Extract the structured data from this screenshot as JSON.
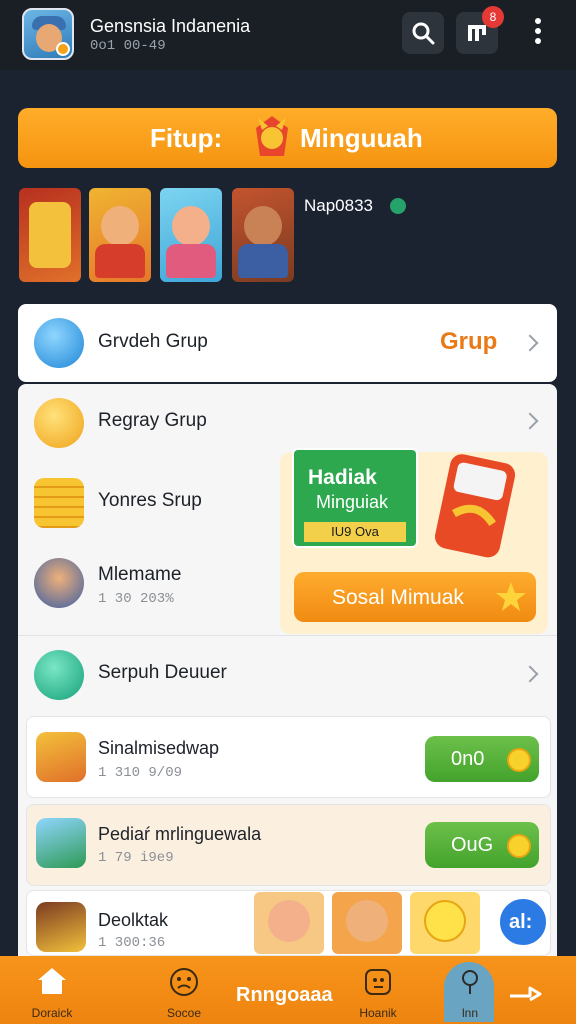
{
  "header": {
    "title": "Gensnsia Indanenia",
    "subtitle": "0o1 00-49",
    "notification_count": "8"
  },
  "banner": {
    "left_text": "Fitup:",
    "right_text": "Minguuah"
  },
  "gallery": {
    "label": "Nap0833"
  },
  "rows": [
    {
      "label": "Grvdeh Grup",
      "link": "Grup"
    },
    {
      "label": "Regray Grup"
    },
    {
      "label": "Yonres Srup"
    },
    {
      "label": "Mlemame",
      "sub": "1 30 203%"
    },
    {
      "label": "Serpuh Deuuer"
    },
    {
      "label": "Sinalmisedwap",
      "sub": "1 310 9/09",
      "button": "0n0"
    },
    {
      "label": "Pediaŕ mrlinguewala",
      "sub": "1 79 i9e9",
      "button": "OuG"
    },
    {
      "label": "Deolktak",
      "sub": "1 300:36"
    }
  ],
  "promo": {
    "title": "Hadiak",
    "subtitle": "Minguiak",
    "tag": "IU9 Ova",
    "button": "Sosal Mimuak"
  },
  "chat_button": "al:",
  "nav": {
    "items": [
      {
        "label": "Doraick",
        "icon": "home-icon"
      },
      {
        "label": "Socoe",
        "icon": "face-icon"
      },
      {
        "label": "Hoanik",
        "icon": "profile-icon"
      },
      {
        "label": "lnn",
        "icon": "pin-icon"
      }
    ],
    "center_label": "Rnngoaaa"
  },
  "colors": {
    "accent_orange": "#f59410",
    "header_bg": "#1a1f26",
    "green": "#43a32c"
  }
}
